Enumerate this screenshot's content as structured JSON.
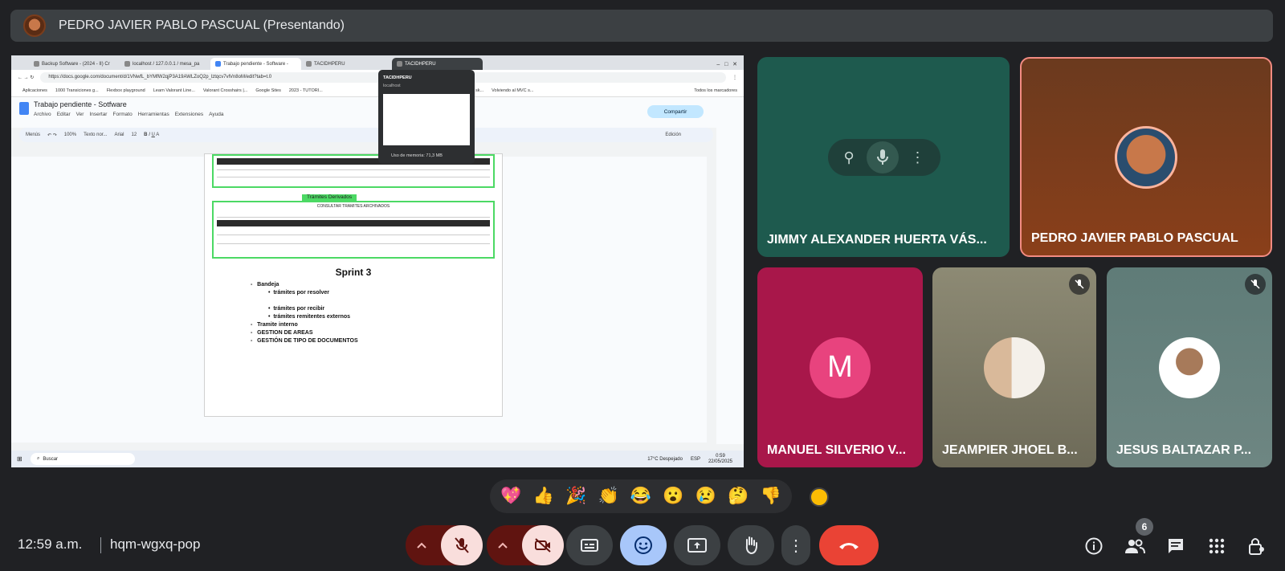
{
  "presenter": {
    "title": "PEDRO JAVIER PABLO PASCUAL (Presentando)"
  },
  "shared_screen": {
    "tabs": [
      "Backup Software - (2024 - II) Cr",
      "localhost / 127.0.0.1 / mesa_pa",
      "Trabajo pendiente - Software -",
      "TACIDHPERU",
      "TACIDHPERU"
    ],
    "url": "https://docs.google.com/document/d/1VNwfL_bYMfW2qjP3A19AWLZoQ2p_lztqcv7vlVn8oM/edit?tab=t.0",
    "bookmarks": [
      "Aplicaciones",
      "1000 Transiciones g...",
      "Flexbox playground",
      "Learn Valorant Line...",
      "Valorant Crosshairs |...",
      "Google Sites",
      "2023 - TUTORI...",
      "Como INSTALAR sk...",
      "Volviendo al MVC s...",
      "Todos los marcadores"
    ],
    "doc_title": "Trabajo pendiente - Sotfware",
    "doc_menu": [
      "Archivo",
      "Editar",
      "Ver",
      "Insertar",
      "Formato",
      "Herramientas",
      "Extensiones",
      "Ayuda"
    ],
    "share_label": "Compartir",
    "toolbar": {
      "menus": "Menús",
      "zoom": "100%",
      "style": "Texto nor...",
      "font": "Arial",
      "size": "12",
      "mode": "Edición"
    },
    "popup": {
      "title": "TACIDHPERU",
      "host": "localhost",
      "memory": "Uso de memoria: 71,3 MB"
    },
    "doc": {
      "derivados": "Trámites Derivados",
      "archivados": "CONSULTAR TRAMITES ARCHIVADOS",
      "sprint": "Sprint 3",
      "bullets": [
        "Bandeja",
        "trámites por resolver",
        "trámites por recibir",
        "trámites remitentes externos",
        "Tramite interno",
        "GESTION DE AREAS",
        "GESTIÓN DE TIPO DE DOCUMENTOS"
      ]
    },
    "taskbar": {
      "search": "Buscar",
      "weather": "17°C  Despejado",
      "lang": "ESP",
      "time": "0:59",
      "date": "22/05/2025"
    }
  },
  "participants": [
    {
      "name": "JIMMY ALEXANDER HUERTA VÁS..."
    },
    {
      "name": "PEDRO JAVIER PABLO PASCUAL"
    },
    {
      "name": "MANUEL SILVERIO V...",
      "initial": "M"
    },
    {
      "name": "JEAMPIER JHOEL B..."
    },
    {
      "name": "JESUS BALTAZAR P..."
    }
  ],
  "reactions": [
    "💖",
    "👍",
    "🎉",
    "👏",
    "😂",
    "😮",
    "😢",
    "🤔",
    "👎"
  ],
  "meeting": {
    "time": "12:59 a.m.",
    "code": "hqm-wgxq-pop",
    "people_count": "6"
  },
  "colors": {
    "accent": "#a8c7fa",
    "end_call": "#ea4335",
    "active_speaker": "#f28b82"
  }
}
